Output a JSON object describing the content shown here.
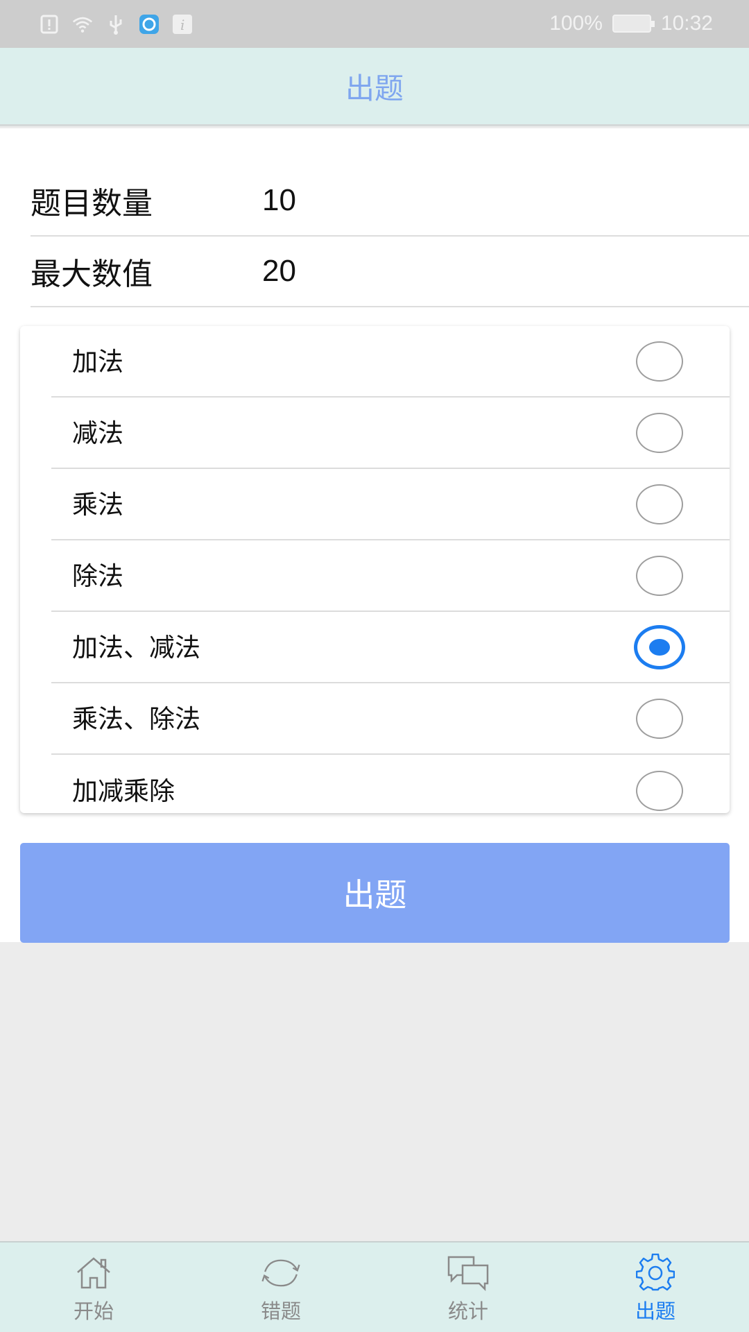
{
  "status_bar": {
    "battery_text": "100%",
    "time": "10:32",
    "icons": [
      "alert-icon",
      "wifi-icon",
      "usb-icon",
      "app-notification-icon",
      "info-icon",
      "battery-icon"
    ]
  },
  "app_bar": {
    "title": "出题"
  },
  "form": {
    "count_label": "题目数量",
    "count_value": "10",
    "max_label": "最大数值",
    "max_value": "20"
  },
  "options": [
    {
      "label": "加法",
      "checked": false
    },
    {
      "label": "减法",
      "checked": false
    },
    {
      "label": "乘法",
      "checked": false
    },
    {
      "label": "除法",
      "checked": false
    },
    {
      "label": "加法、减法",
      "checked": true
    },
    {
      "label": "乘法、除法",
      "checked": false
    },
    {
      "label": "加减乘除",
      "checked": false
    }
  ],
  "submit_label": "出题",
  "bottom_nav": {
    "items": [
      {
        "label": "开始",
        "icon": "home-icon",
        "active": false
      },
      {
        "label": "错题",
        "icon": "refresh-icon",
        "active": false
      },
      {
        "label": "统计",
        "icon": "chat-icon",
        "active": false
      },
      {
        "label": "出题",
        "icon": "gear-icon",
        "active": true
      }
    ]
  },
  "colors": {
    "accent": "#1c7df0",
    "app_bar_bg": "#dcefed",
    "title_color": "#7fa6ef",
    "button_bg": "#82a5f4"
  }
}
